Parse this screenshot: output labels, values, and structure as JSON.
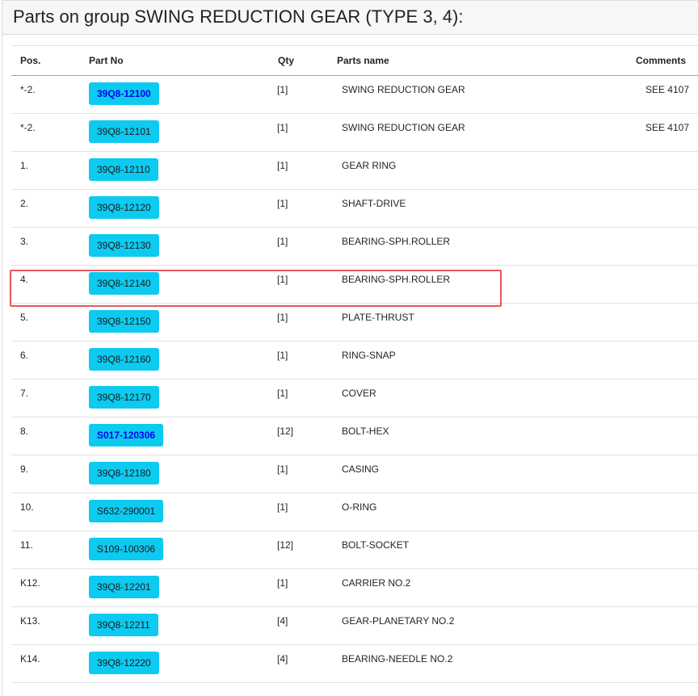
{
  "page": {
    "title": "Parts on group SWING REDUCTION GEAR (TYPE 3, 4):"
  },
  "table": {
    "headers": {
      "pos": "Pos.",
      "part_no": "Part No",
      "qty": "Qty",
      "name": "Parts name",
      "comments": "Comments"
    },
    "rows": [
      {
        "pos": "*-2.",
        "part_no": "39Q8-12100",
        "qty": "[1]",
        "name": "SWING REDUCTION GEAR",
        "comment": "SEE 4107",
        "link_style": "bold-blue"
      },
      {
        "pos": "*-2.",
        "part_no": "39Q8-12101",
        "qty": "[1]",
        "name": "SWING REDUCTION GEAR",
        "comment": "SEE 4107",
        "link_style": "normal"
      },
      {
        "pos": "1.",
        "part_no": "39Q8-12110",
        "qty": "[1]",
        "name": "GEAR RING",
        "comment": "",
        "link_style": "normal"
      },
      {
        "pos": "2.",
        "part_no": "39Q8-12120",
        "qty": "[1]",
        "name": "SHAFT-DRIVE",
        "comment": "",
        "link_style": "normal"
      },
      {
        "pos": "3.",
        "part_no": "39Q8-12130",
        "qty": "[1]",
        "name": "BEARING-SPH.ROLLER",
        "comment": "",
        "link_style": "normal"
      },
      {
        "pos": "4.",
        "part_no": "39Q8-12140",
        "qty": "[1]",
        "name": "BEARING-SPH.ROLLER",
        "comment": "",
        "link_style": "normal"
      },
      {
        "pos": "5.",
        "part_no": "39Q8-12150",
        "qty": "[1]",
        "name": "PLATE-THRUST",
        "comment": "",
        "link_style": "normal"
      },
      {
        "pos": "6.",
        "part_no": "39Q8-12160",
        "qty": "[1]",
        "name": "RING-SNAP",
        "comment": "",
        "link_style": "normal"
      },
      {
        "pos": "7.",
        "part_no": "39Q8-12170",
        "qty": "[1]",
        "name": "COVER",
        "comment": "",
        "link_style": "normal"
      },
      {
        "pos": "8.",
        "part_no": "S017-120306",
        "qty": "[12]",
        "name": "BOLT-HEX",
        "comment": "",
        "link_style": "bold-blue"
      },
      {
        "pos": "9.",
        "part_no": "39Q8-12180",
        "qty": "[1]",
        "name": "CASING",
        "comment": "",
        "link_style": "normal"
      },
      {
        "pos": "10.",
        "part_no": "S632-290001",
        "qty": "[1]",
        "name": "O-RING",
        "comment": "",
        "link_style": "normal"
      },
      {
        "pos": "11.",
        "part_no": "S109-100306",
        "qty": "[12]",
        "name": "BOLT-SOCKET",
        "comment": "",
        "link_style": "normal"
      },
      {
        "pos": "K12.",
        "part_no": "39Q8-12201",
        "qty": "[1]",
        "name": "CARRIER NO.2",
        "comment": "",
        "link_style": "normal"
      },
      {
        "pos": "K13.",
        "part_no": "39Q8-12211",
        "qty": "[4]",
        "name": "GEAR-PLANETARY NO.2",
        "comment": "",
        "link_style": "normal"
      },
      {
        "pos": "K14.",
        "part_no": "39Q8-12220",
        "qty": "[4]",
        "name": "BEARING-NEEDLE NO.2",
        "comment": "",
        "link_style": "normal"
      }
    ]
  },
  "highlighted_row": 5,
  "colors": {
    "button_bg": "#0dcaf0",
    "link_bold": "#0000ee",
    "highlight_border": "#e5585f"
  }
}
